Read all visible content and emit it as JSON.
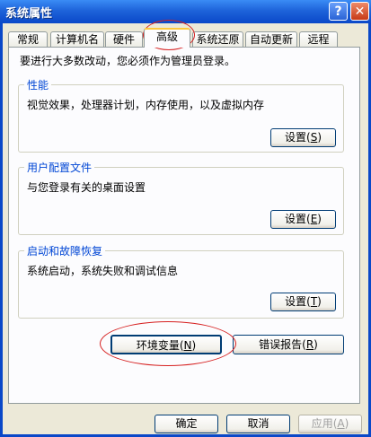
{
  "window": {
    "title": "系统属性",
    "help_glyph": "?",
    "close_glyph": "✕"
  },
  "tabs": [
    {
      "label": "常规",
      "active": false
    },
    {
      "label": "计算机名",
      "active": false
    },
    {
      "label": "硬件",
      "active": false
    },
    {
      "label": "高级",
      "active": true
    },
    {
      "label": "系统还原",
      "active": false
    },
    {
      "label": "自动更新",
      "active": false
    },
    {
      "label": "远程",
      "active": false
    }
  ],
  "intro": "要进行大多数改动，您必须作为管理员登录。",
  "performance": {
    "title": "性能",
    "desc": "视觉效果，处理器计划，内存使用，以及虚拟内存",
    "button": "设置",
    "hotkey": "S"
  },
  "profiles": {
    "title": "用户配置文件",
    "desc": "与您登录有关的桌面设置",
    "button": "设置",
    "hotkey": "E"
  },
  "startup": {
    "title": "启动和故障恢复",
    "desc": "系统启动，系统失败和调试信息",
    "button": "设置",
    "hotkey": "T"
  },
  "env_button": {
    "label": "环境变量",
    "hotkey": "N"
  },
  "error_button": {
    "label": "错误报告",
    "hotkey": "R"
  },
  "footer": {
    "ok": "确定",
    "cancel": "取消",
    "apply": "应用",
    "apply_hotkey": "A"
  },
  "colors": {
    "titlebar": "#1E63DA",
    "group_title": "#0046D5",
    "annotation": "#D62020",
    "face": "#ECE9D8"
  }
}
